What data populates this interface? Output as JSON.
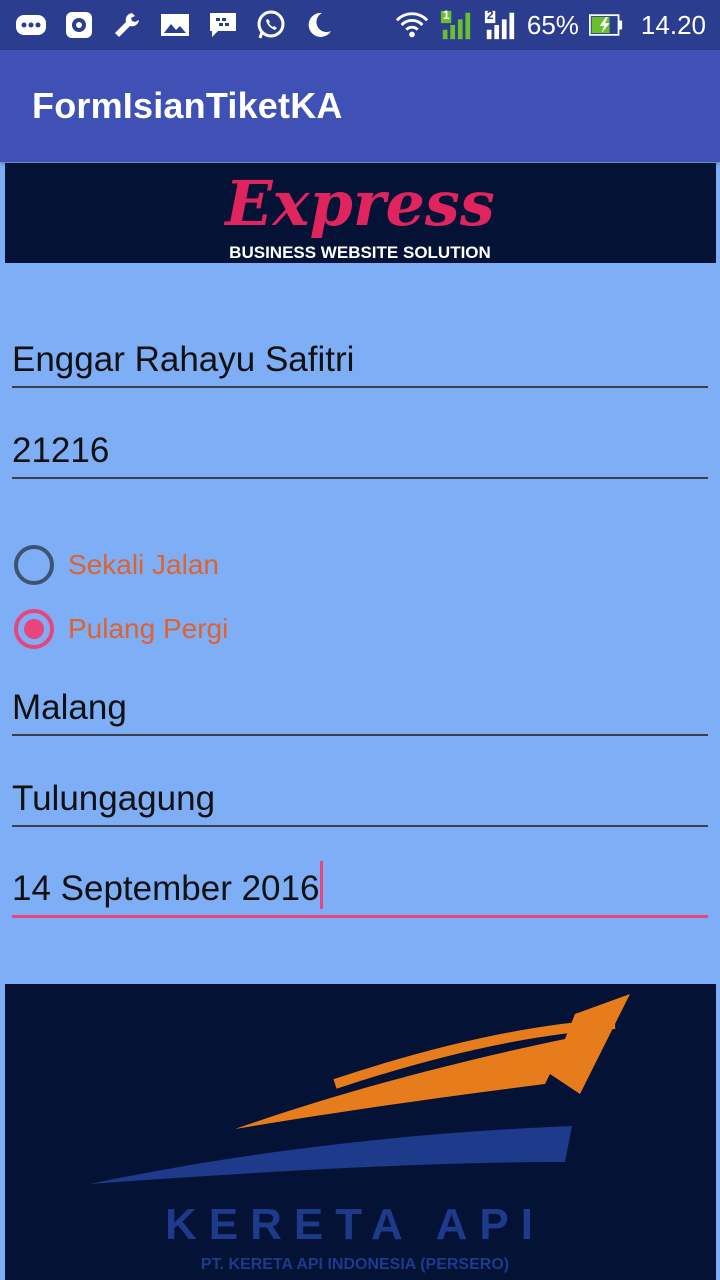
{
  "status_bar": {
    "battery": "65%",
    "time": "14.20",
    "sim1": "1",
    "sim2": "2"
  },
  "app_bar": {
    "title": "FormIsianTiketKA"
  },
  "top_banner": {
    "logo_text": "Express",
    "tagline": "BUSINESS WEBSITE SOLUTION"
  },
  "form": {
    "name": "Enggar Rahayu Safitri",
    "id_number": "21216",
    "trip_type": {
      "options": [
        {
          "label": "Sekali Jalan",
          "checked": false
        },
        {
          "label": "Pulang Pergi",
          "checked": true
        }
      ]
    },
    "origin": "Malang",
    "destination": "Tulungagung",
    "date": "14 September 2016"
  },
  "bottom_banner": {
    "brand": "KERETA API",
    "company": "PT. KERETA API INDONESIA (PERSERO)"
  },
  "colors": {
    "status_bar": "#2a3d8f",
    "app_bar": "#3f51b5",
    "background": "#7eaef5",
    "accent": "#e8457c",
    "radio_label": "#e0622c",
    "banner_bg": "#041236",
    "train_orange": "#e67c1b",
    "train_blue": "#1e3a8a"
  }
}
